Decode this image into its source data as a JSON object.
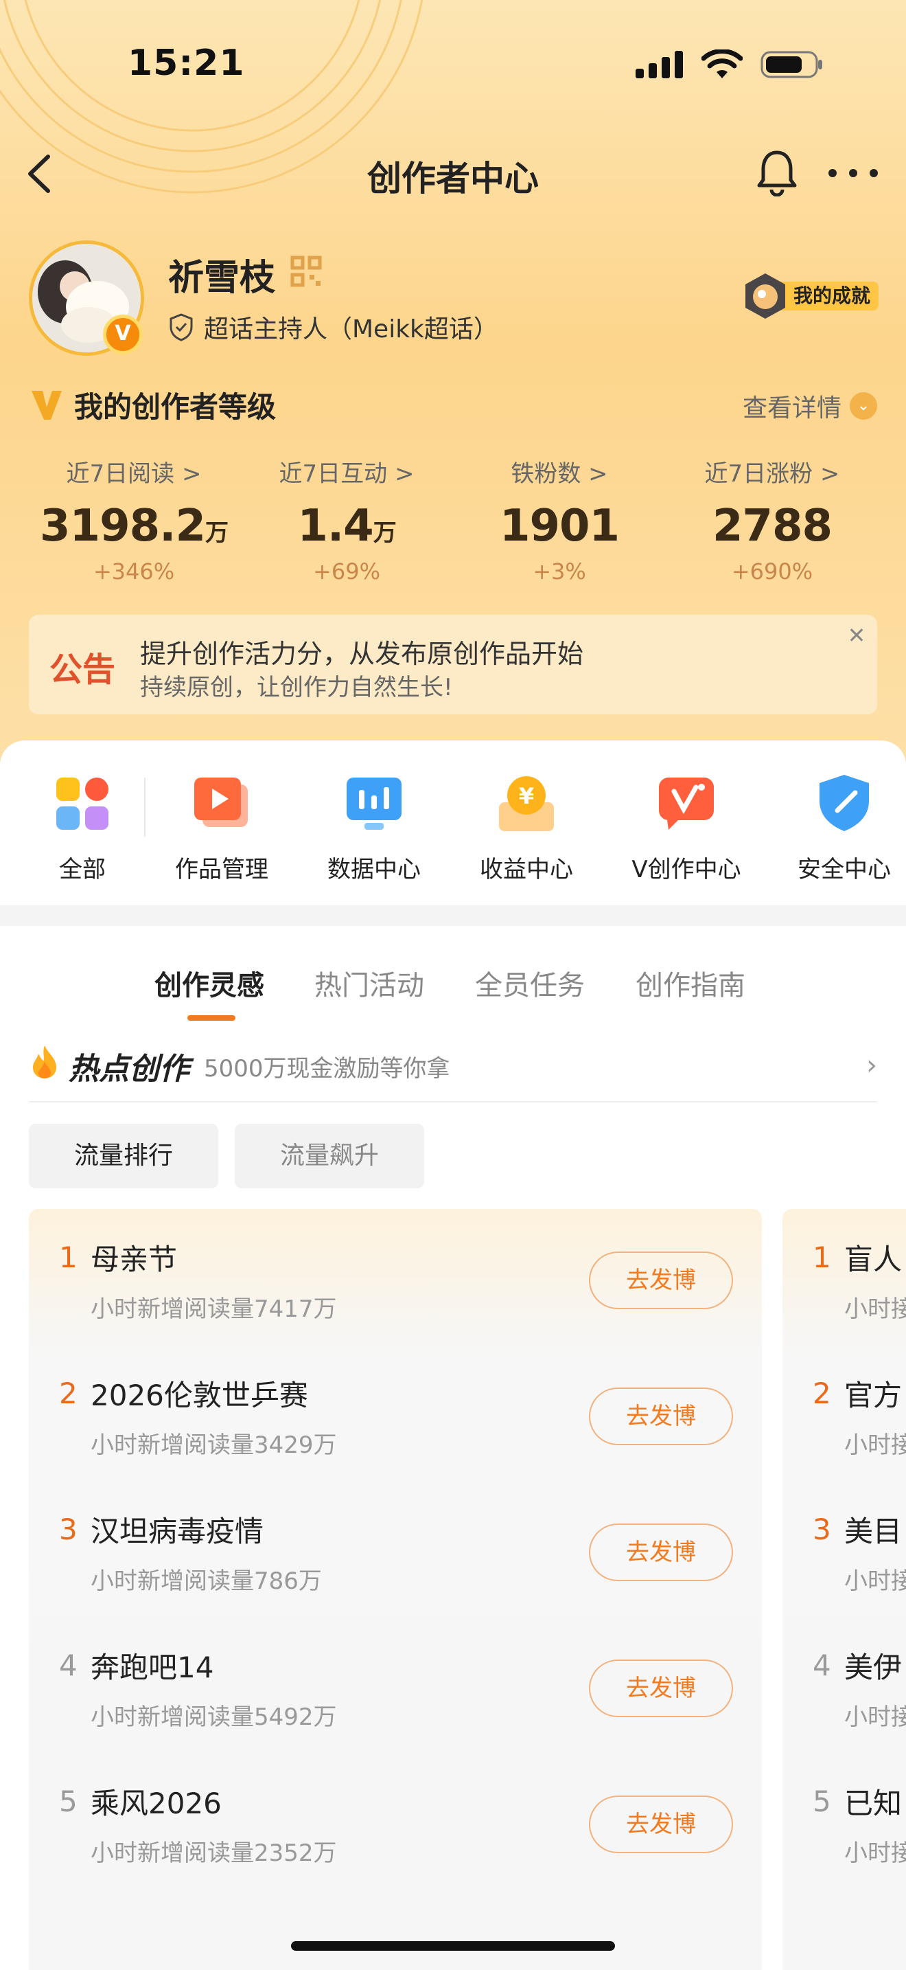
{
  "status_bar": {
    "time": "15:21"
  },
  "nav": {
    "title": "创作者中心"
  },
  "profile": {
    "name": "祈雪枝",
    "role": "超话主持人（Meikk超话）",
    "achievement_label": "我的成就"
  },
  "level": {
    "title": "我的创作者等级",
    "detail_label": "查看详情"
  },
  "stats": [
    {
      "label": "近7日阅读 >",
      "value": "3198.2",
      "unit": "万",
      "change": "+346%"
    },
    {
      "label": "近7日互动 >",
      "value": "1.4",
      "unit": "万",
      "change": "+69%"
    },
    {
      "label": "铁粉数 >",
      "value": "1901",
      "unit": "",
      "change": "+3%"
    },
    {
      "label": "近7日涨粉 >",
      "value": "2788",
      "unit": "",
      "change": "+690%"
    }
  ],
  "notice": {
    "tag": "公告",
    "main": "提升创作活力分，从发布原创作品开始",
    "sub": "持续原创，让创作力自然生长!"
  },
  "tools": [
    "全部",
    "作品管理",
    "数据中心",
    "收益中心",
    "V创作中心",
    "安全中心"
  ],
  "tabs": [
    "创作灵感",
    "热门活动",
    "全员任务",
    "创作指南"
  ],
  "hot": {
    "title": "热点创作",
    "subtitle": "5000万现金激励等你拿"
  },
  "filters": [
    "流量排行",
    "流量飙升"
  ],
  "ranking_left": [
    {
      "rank": "1",
      "title": "母亲节",
      "sub": "小时新增阅读量7417万",
      "button": "去发博"
    },
    {
      "rank": "2",
      "title": "2026伦敦世乒赛",
      "sub": "小时新增阅读量3429万",
      "button": "去发博"
    },
    {
      "rank": "3",
      "title": "汉坦病毒疫情",
      "sub": "小时新增阅读量786万",
      "button": "去发博"
    },
    {
      "rank": "4",
      "title": "奔跑吧14",
      "sub": "小时新增阅读量5492万",
      "button": "去发博"
    },
    {
      "rank": "5",
      "title": "乘风2026",
      "sub": "小时新增阅读量2352万",
      "button": "去发博"
    }
  ],
  "ranking_right": [
    {
      "rank": "1",
      "title": "盲人",
      "sub": "小时接"
    },
    {
      "rank": "2",
      "title": "官方",
      "sub": "小时接"
    },
    {
      "rank": "3",
      "title": "美目",
      "sub": "小时接"
    },
    {
      "rank": "4",
      "title": "美伊",
      "sub": "小时接"
    },
    {
      "rank": "5",
      "title": "已知",
      "sub": "小时接"
    }
  ],
  "colors": {
    "accent": "#ef7b22",
    "hero_bg": "#fdd58c",
    "rank_top": "#e86a1a"
  }
}
